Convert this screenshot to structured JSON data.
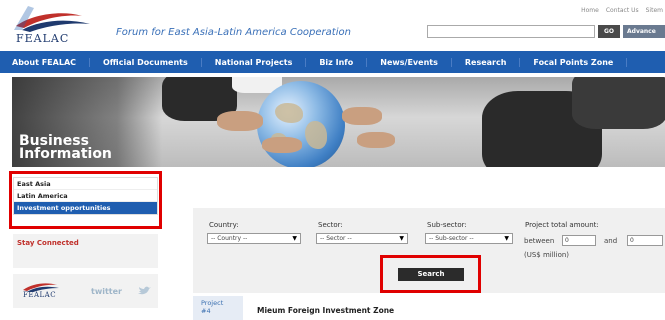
{
  "header": {
    "logo_text": "FEALAC",
    "tagline": "Forum for East Asia-Latin America Cooperation",
    "top_links": [
      "Home",
      "Contact Us",
      "Sitem"
    ],
    "search_value": "",
    "go_label": "GO",
    "advanced_label": "Advance"
  },
  "nav": {
    "items": [
      {
        "label": "About FEALAC"
      },
      {
        "label": "Official Documents"
      },
      {
        "label": "National Projects"
      },
      {
        "label": "Biz Info"
      },
      {
        "label": "News/Events"
      },
      {
        "label": "Research"
      },
      {
        "label": "Focal Points Zone"
      }
    ]
  },
  "banner": {
    "title_line1": "Business",
    "title_line2": "Information"
  },
  "left_menu": {
    "items": [
      {
        "label": "East Asia",
        "active": false
      },
      {
        "label": "Latin America",
        "active": false
      },
      {
        "label": "Investment opportunities",
        "active": true
      }
    ]
  },
  "stay_connected": {
    "title": "Stay Connected"
  },
  "social": {
    "logo_text": "FEALAC",
    "twitter_label": "twitter"
  },
  "filters": {
    "country_label": "Country:",
    "country_value": "-- Country --",
    "sector_label": "Sector:",
    "sector_value": "-- Sector --",
    "subsector_label": "Sub-sector:",
    "subsector_value": "-- Sub-sector --",
    "amount_label": "Project total amount:",
    "between_label": "between",
    "and_label": "and",
    "min_value": "0",
    "max_value": "0",
    "unit_label": "(US$ million)",
    "search_label": "Search"
  },
  "project": {
    "label_line1": "Project",
    "label_line2": "#4",
    "title": "Mieum Foreign Investment Zone"
  },
  "colors": {
    "nav_blue": "#1f5eb0",
    "highlight_red": "#e00000",
    "tagline_blue": "#3a70b8"
  }
}
